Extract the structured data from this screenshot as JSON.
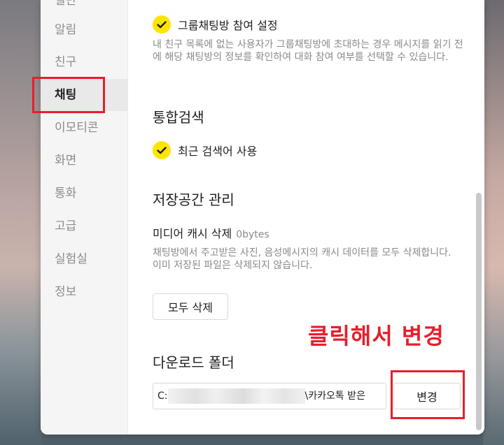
{
  "sidebar": {
    "items": [
      {
        "label": "일반"
      },
      {
        "label": "알림"
      },
      {
        "label": "친구"
      },
      {
        "label": "채팅"
      },
      {
        "label": "이모티콘"
      },
      {
        "label": "화면"
      },
      {
        "label": "통화"
      },
      {
        "label": "고급"
      },
      {
        "label": "실험실"
      },
      {
        "label": "정보"
      }
    ],
    "active": "채팅"
  },
  "group_chat": {
    "checkbox_label": "그룹채팅방 참여 설정",
    "checked": true,
    "description": "내 친구 목록에 없는 사용자가 그룹채팅방에 초대하는 경우 메시지를 읽기 전에 해당 채팅방의 정보를 확인하여 대화 참여 여부를 선택할 수 있습니다."
  },
  "search": {
    "title": "통합검색",
    "recent_label": "최근 검색어 사용",
    "checked": true
  },
  "storage": {
    "title": "저장공간 관리",
    "cache_label": "미디어 캐시 삭제",
    "cache_size": "0bytes",
    "desc1": "채팅방에서 주고받은 사진, 음성메시지의 캐시 데이터를 모두 삭제합니다.",
    "desc2": "이미 저장된 파일은 삭제되지 않습니다.",
    "delete_all_button": "모두 삭제"
  },
  "download": {
    "title": "다운로드 폴더",
    "path_prefix": "C:",
    "path_suffix": "\\카카오톡 받은",
    "change_button": "변경"
  },
  "annotation": {
    "text": "클릭해서 변경",
    "color": "#e81e2b"
  },
  "colors": {
    "check": "#fee500",
    "highlight": "#e81e2b"
  }
}
